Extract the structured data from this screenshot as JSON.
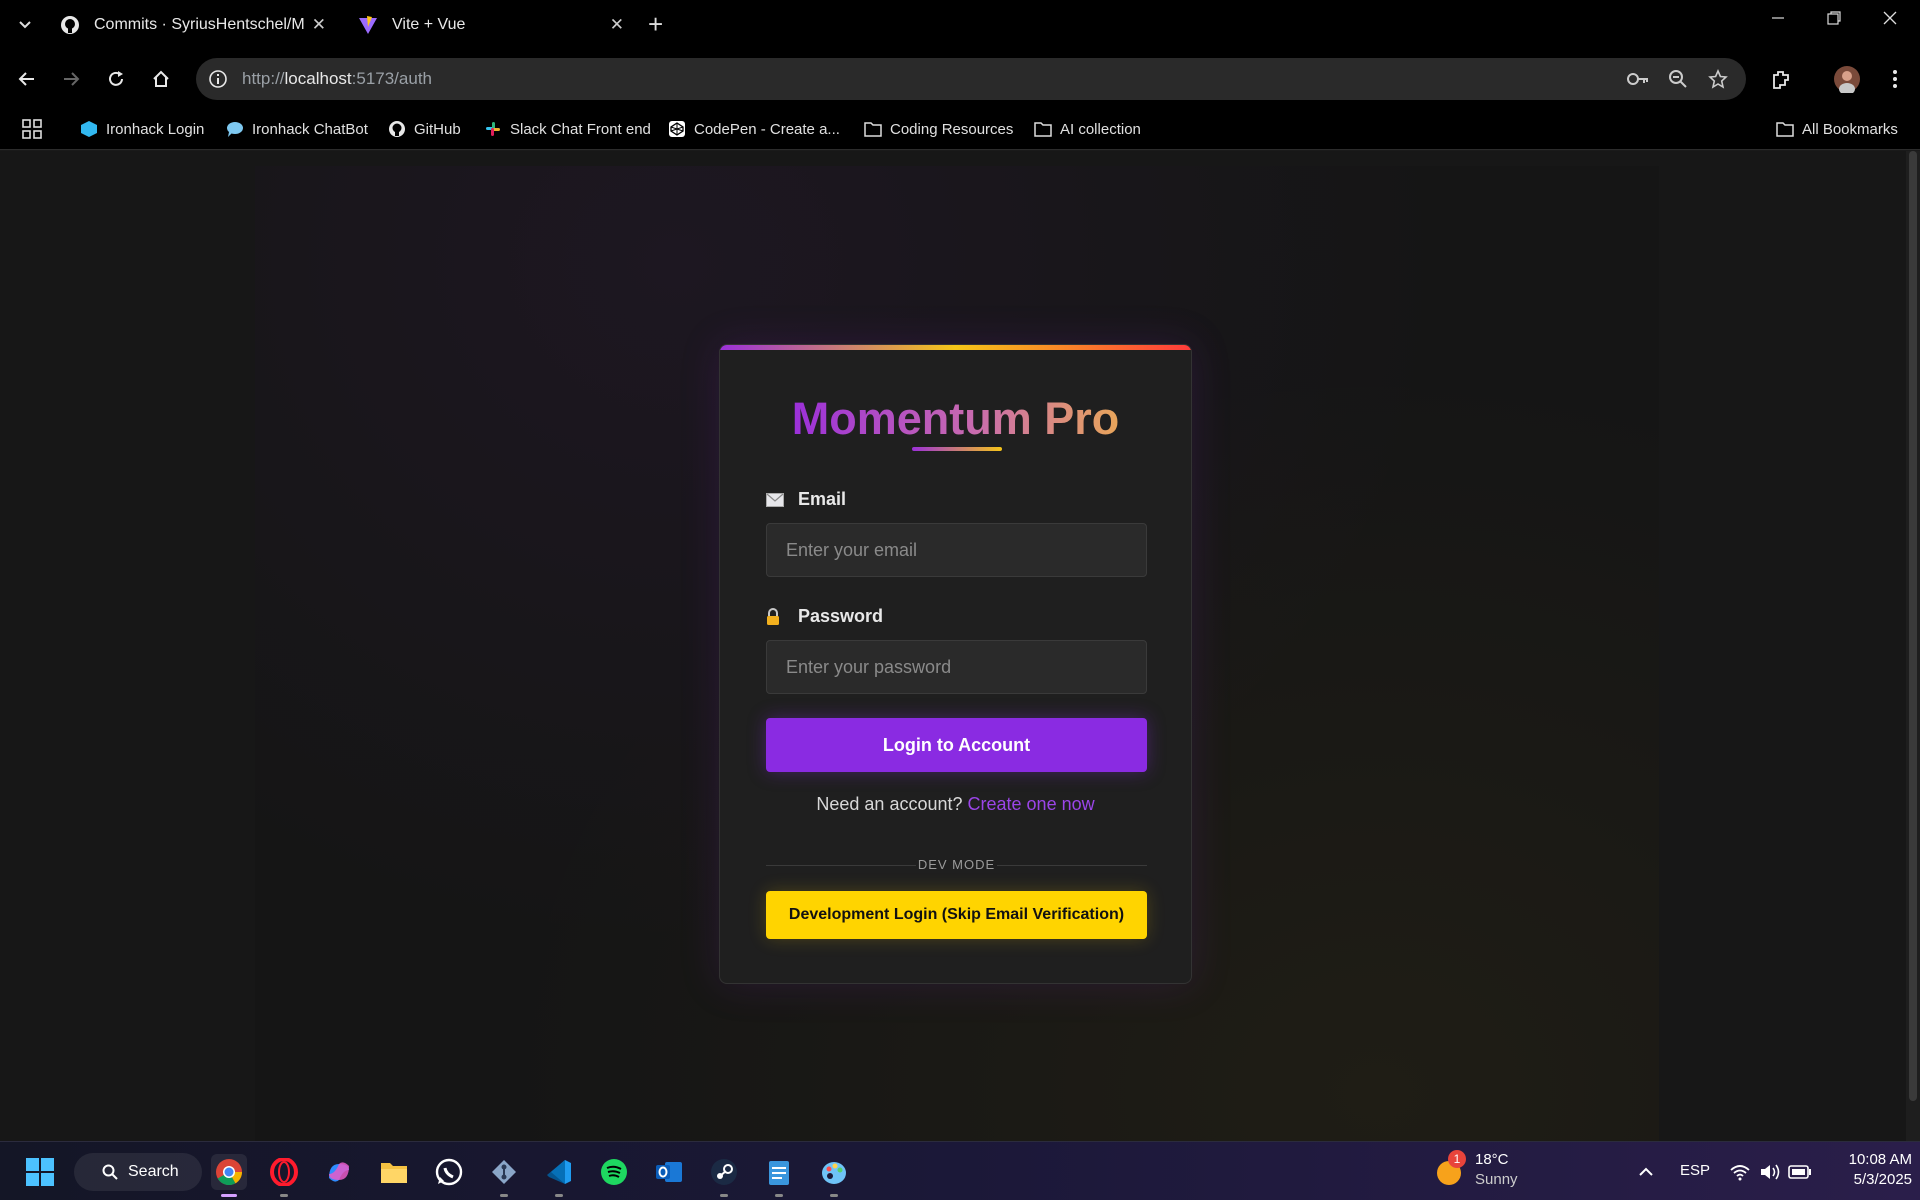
{
  "browser": {
    "tabs": [
      {
        "title": "Commits · SyriusHentschel/Mor",
        "active": true
      },
      {
        "title": "Vite + Vue",
        "active": false
      }
    ],
    "url_scheme": "http://",
    "url_host": "localhost",
    "url_rest": ":5173/auth",
    "bookmarks": [
      {
        "label": "Ironhack Login",
        "icon": "ironhack-icon"
      },
      {
        "label": "Ironhack ChatBot",
        "icon": "chat-bubble-icon"
      },
      {
        "label": "GitHub",
        "icon": "github-icon"
      },
      {
        "label": "Slack Chat Front end",
        "icon": "slack-icon"
      },
      {
        "label": "CodePen - Create a...",
        "icon": "codepen-icon"
      },
      {
        "label": "Coding Resources",
        "icon": "folder-icon"
      },
      {
        "label": "AI collection",
        "icon": "folder-icon"
      }
    ],
    "all_bookmarks": "All Bookmarks"
  },
  "login": {
    "brand": "Momentum Pro",
    "email_label": "Email",
    "email_placeholder": "Enter your email",
    "password_label": "Password",
    "password_placeholder": "Enter your password",
    "login_button": "Login to Account",
    "signup_prompt": "Need an account?",
    "signup_link": "Create one now",
    "divider_text": "DEV MODE",
    "dev_button": "Development Login (Skip Email Verification)",
    "colors": {
      "accent": "#8a2be2",
      "dev": "#ffd400"
    }
  },
  "taskbar": {
    "search_label": "Search",
    "weather_temp": "18°C",
    "weather_desc": "Sunny",
    "weather_badge": "1",
    "language": "ESP",
    "time": "10:08 AM",
    "date": "5/3/2025"
  }
}
